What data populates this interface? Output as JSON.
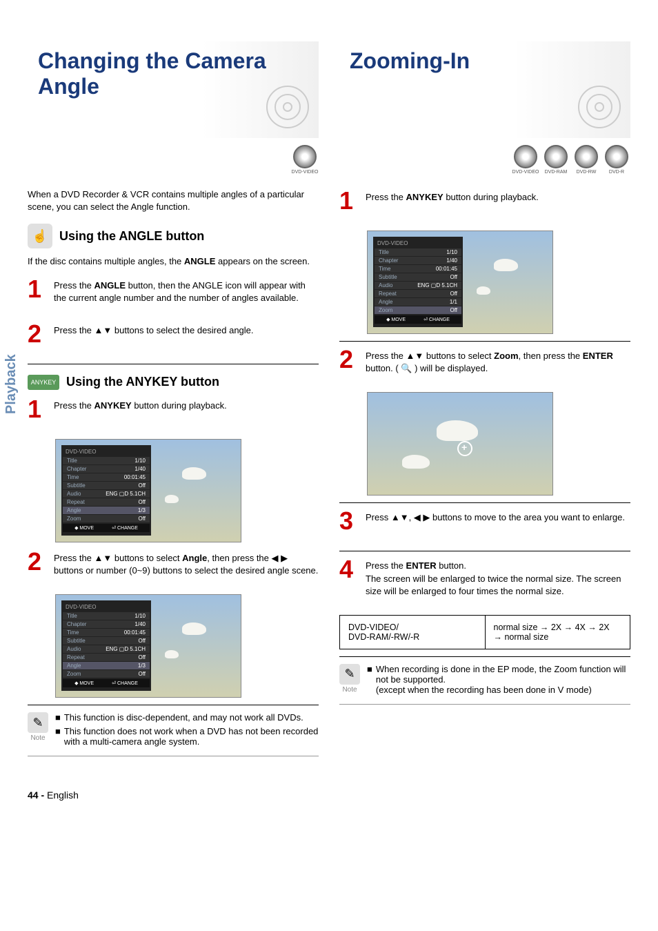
{
  "sideTab": "Playback",
  "left": {
    "title": "Changing the Camera Angle",
    "discIcons": [
      "DVD-VIDEO"
    ],
    "intro": "When a DVD Recorder & VCR contains multiple angles of a particular scene, you can select the Angle function.",
    "sectionA": {
      "title": "Using the ANGLE button",
      "desc_pre": "If the disc contains multiple angles, the ",
      "desc_bold": "ANGLE",
      "desc_post": " appears on the screen.",
      "step1": {
        "num": "1",
        "t1": "Press the ",
        "b1": "ANGLE",
        "t2": " button, then the ANGLE icon will appear with the current angle number and the number of angles available."
      },
      "step2": {
        "num": "2",
        "t1": "Press the ▲▼ buttons to select the desired angle."
      }
    },
    "sectionB": {
      "badge": "ANYKEY",
      "title": "Using the ANYKEY button",
      "step1": {
        "num": "1",
        "t1": "Press the ",
        "b1": "ANYKEY",
        "t2": " button during playback."
      },
      "osd1": {
        "header": "DVD-VIDEO",
        "rows": [
          {
            "label": "Title",
            "val": "1/10"
          },
          {
            "label": "Chapter",
            "val": "1/40"
          },
          {
            "label": "Time",
            "val": "00:01:45"
          },
          {
            "label": "Subtitle",
            "val": "Off"
          },
          {
            "label": "Audio",
            "val": "ENG ▢D 5.1CH"
          },
          {
            "label": "Repeat",
            "val": "Off"
          },
          {
            "label": "Angle",
            "val": "1/3"
          },
          {
            "label": "Zoom",
            "val": "Off"
          }
        ],
        "footer": {
          "move": "MOVE",
          "change": "CHANGE"
        }
      },
      "step2": {
        "num": "2",
        "t1": "Press the ▲▼ buttons to select ",
        "b1": "Angle",
        "t2": ", then press the ◀ ▶ buttons or number (0~9) buttons to select the desired angle scene."
      },
      "osd2": {
        "header": "DVD-VIDEO",
        "rows": [
          {
            "label": "Title",
            "val": "1/10"
          },
          {
            "label": "Chapter",
            "val": "1/40"
          },
          {
            "label": "Time",
            "val": "00:01:45"
          },
          {
            "label": "Subtitle",
            "val": "Off"
          },
          {
            "label": "Audio",
            "val": "ENG ▢D 5.1CH"
          },
          {
            "label": "Repeat",
            "val": "Off"
          },
          {
            "label": "Angle",
            "val": "1/3"
          },
          {
            "label": "Zoom",
            "val": "Off"
          }
        ],
        "footer": {
          "move": "MOVE",
          "change": "CHANGE"
        }
      }
    },
    "note": {
      "label": "Note",
      "b1": "This function is disc-dependent, and may not work all DVDs.",
      "b2": "This function does not work when a DVD has not been recorded with a multi-camera angle system."
    }
  },
  "right": {
    "title": "Zooming-In",
    "discIcons": [
      "DVD-VIDEO",
      "DVD-RAM",
      "DVD-RW",
      "DVD-R"
    ],
    "step1": {
      "num": "1",
      "t1": "Press the ",
      "b1": "ANYKEY",
      "t2": " button during playback."
    },
    "osd1": {
      "header": "DVD-VIDEO",
      "rows": [
        {
          "label": "Title",
          "val": "1/10"
        },
        {
          "label": "Chapter",
          "val": "1/40"
        },
        {
          "label": "Time",
          "val": "00:01:45"
        },
        {
          "label": "Subtitle",
          "val": "Off"
        },
        {
          "label": "Audio",
          "val": "ENG ▢D 5.1CH"
        },
        {
          "label": "Repeat",
          "val": "Off"
        },
        {
          "label": "Angle",
          "val": "1/1"
        },
        {
          "label": "Zoom",
          "val": "Off"
        }
      ],
      "footer": {
        "move": "MOVE",
        "change": "CHANGE"
      }
    },
    "step2": {
      "num": "2",
      "t1": "Press the ▲▼ buttons to select ",
      "b1": "Zoom",
      "t2": ", then press the ",
      "b2": "ENTER",
      "t3": " button. ( 🔍 ) will be displayed."
    },
    "step3": {
      "num": "3",
      "t1": "Press ▲▼, ◀ ▶ buttons to move to the area you want to enlarge."
    },
    "step4": {
      "num": "4",
      "t1": "Press the ",
      "b1": "ENTER",
      "t2": " button.",
      "t3": "The screen will be enlarged to twice the normal size. The screen size will be enlarged to four times the normal size."
    },
    "table": {
      "c1a": "DVD-VIDEO/",
      "c1b": "DVD-RAM/-RW/-R",
      "c2a": "normal size → 2X → 4X → 2X",
      "c2b": "→ normal size"
    },
    "note": {
      "label": "Note",
      "b1": "When recording is done in the EP mode, the Zoom function will not be supported.",
      "b2": "(except when the recording has been done in V mode)"
    }
  },
  "footer": {
    "page": "44 -",
    "lang": "English"
  }
}
